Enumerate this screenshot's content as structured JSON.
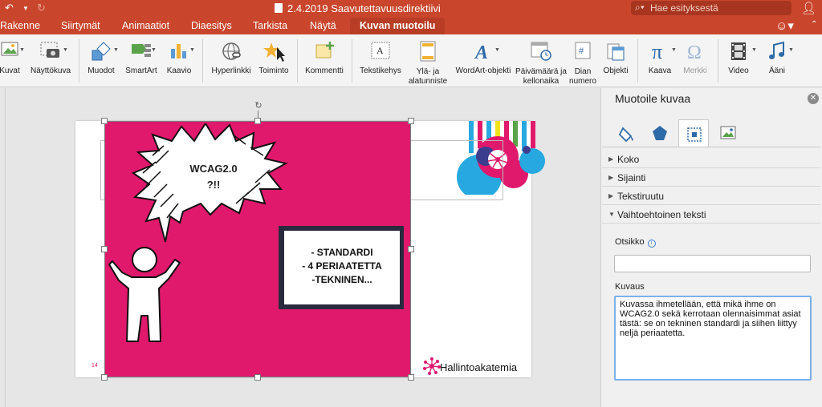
{
  "titlebar": {
    "doc_title": "2.4.2019 Saavutettavuusdirektiivi",
    "search_placeholder": "Hae esityksestä"
  },
  "tabs": [
    {
      "label": "Rakenne"
    },
    {
      "label": "Siirtymät"
    },
    {
      "label": "Animaatiot"
    },
    {
      "label": "Diaesitys"
    },
    {
      "label": "Tarkista"
    },
    {
      "label": "Näytä"
    },
    {
      "label": "Kuvan muotoilu",
      "active": true
    }
  ],
  "ribbon": {
    "kuvat": "Kuvat",
    "nayttokuva": "Näyttökuva",
    "muodot": "Muodot",
    "smartart": "SmartArt",
    "kaavio": "Kaavio",
    "hyperlinkki": "Hyperlinkki",
    "toiminto": "Toiminto",
    "kommentti": "Kommentti",
    "tekstikehys": "Tekstikehys",
    "yla_alatunniste": "Ylä- ja alatunniste",
    "wordart": "WordArt-objekti",
    "paivamaara": "Päivämäärä ja kellonaika",
    "dian_numero": "Dian numero",
    "objekti": "Objekti",
    "kaava": "Kaava",
    "merkki": "Merkki",
    "video": "Video",
    "aani": "Ääni"
  },
  "slide": {
    "bubble_line1": "WCAG2.0",
    "bubble_line2": "?!!",
    "box_line1": "- STANDARDI",
    "box_line2": "- 4 PERIAATETTA",
    "box_line3": "-TEKNINEN...",
    "slide_number": "14",
    "brand": "Hallintoakatemia",
    "pink_color": "#e0196d"
  },
  "panel": {
    "title": "Muotoile kuvaa",
    "sections": [
      {
        "label": "Koko",
        "expanded": false
      },
      {
        "label": "Sijainti",
        "expanded": false
      },
      {
        "label": "Tekstiruutu",
        "expanded": false
      },
      {
        "label": "Vaihtoehtoinen teksti",
        "expanded": true
      }
    ],
    "otsikko_label": "Otsikko",
    "otsikko_value": "",
    "kuvaus_label": "Kuvaus",
    "kuvaus_value": "Kuvassa ihmetellään, että mikä ihme on WCAG2.0 sekä kerrotaan olennaisimmat asiat tästä: se on tekninen standardi ja siihen liittyy neljä periaatetta."
  }
}
